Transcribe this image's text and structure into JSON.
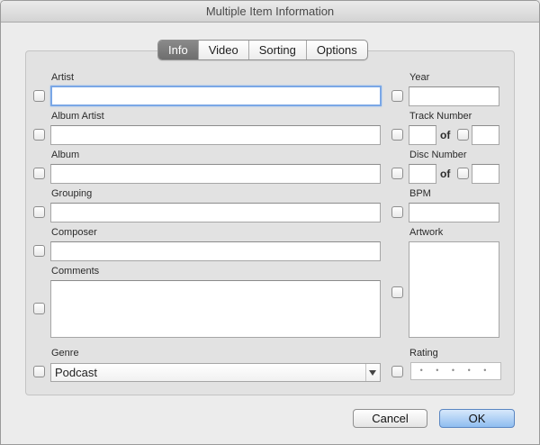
{
  "window": {
    "title": "Multiple Item Information"
  },
  "tabs": [
    {
      "label": "Info",
      "active": true
    },
    {
      "label": "Video",
      "active": false
    },
    {
      "label": "Sorting",
      "active": false
    },
    {
      "label": "Options",
      "active": false
    }
  ],
  "fields": {
    "artist": {
      "label": "Artist",
      "value": ""
    },
    "album_artist": {
      "label": "Album Artist",
      "value": ""
    },
    "album": {
      "label": "Album",
      "value": ""
    },
    "grouping": {
      "label": "Grouping",
      "value": ""
    },
    "composer": {
      "label": "Composer",
      "value": ""
    },
    "comments": {
      "label": "Comments",
      "value": ""
    },
    "genre": {
      "label": "Genre",
      "value": "Podcast"
    },
    "year": {
      "label": "Year",
      "value": ""
    },
    "track_number": {
      "label": "Track Number",
      "value": "",
      "of_label": "of",
      "total": ""
    },
    "disc_number": {
      "label": "Disc Number",
      "value": "",
      "of_label": "of",
      "total": ""
    },
    "bpm": {
      "label": "BPM",
      "value": ""
    },
    "artwork": {
      "label": "Artwork"
    },
    "rating": {
      "label": "Rating",
      "value": "• • • • •",
      "stars": 0
    }
  },
  "buttons": {
    "cancel": "Cancel",
    "ok": "OK"
  },
  "colors": {
    "focus_ring": "#7aa7e6",
    "ok_button": "#8fbdf0",
    "active_tab": "#7c7c7c"
  }
}
